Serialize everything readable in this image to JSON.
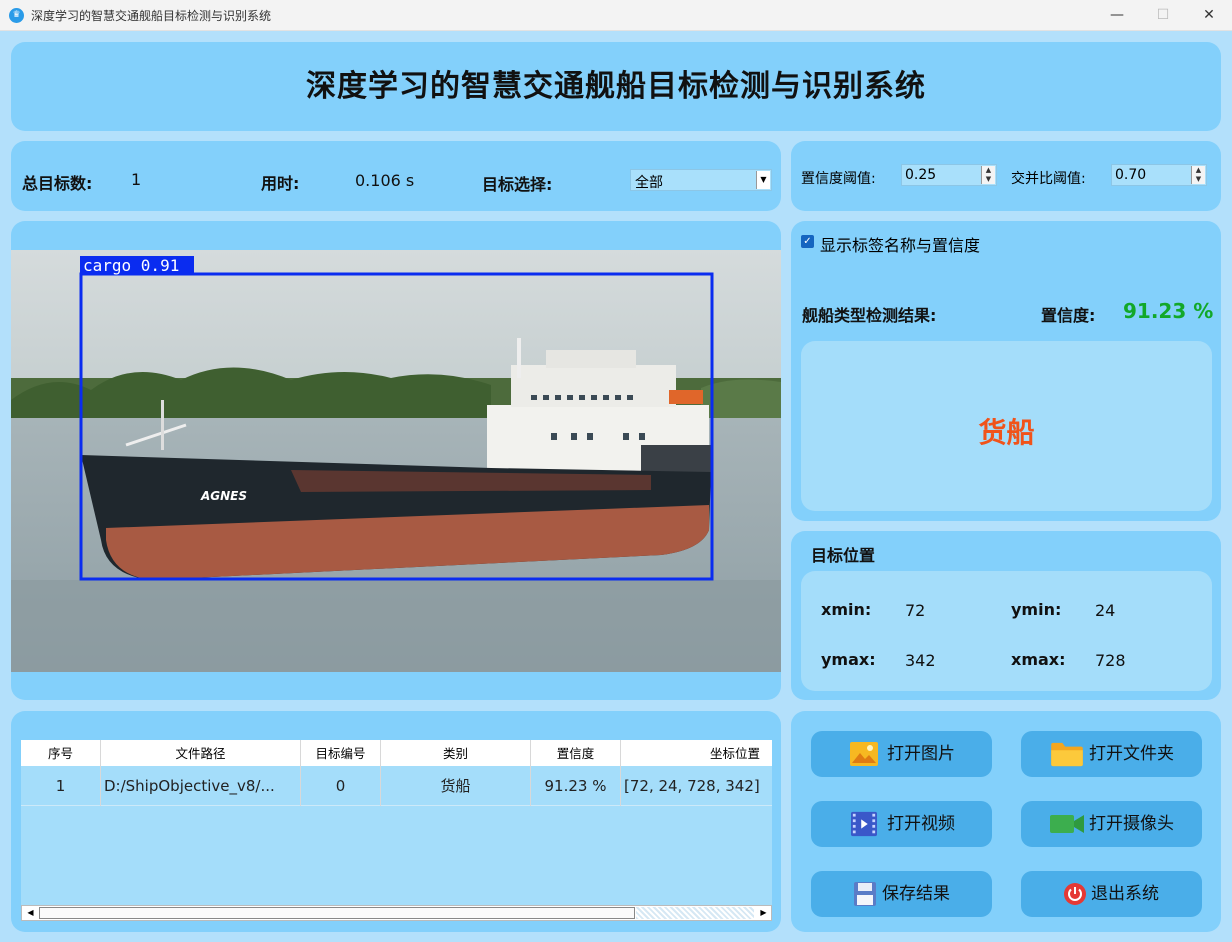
{
  "window": {
    "title": "深度学习的智慧交通舰船目标检测与识别系统",
    "minimize": "—",
    "maximize": "☐",
    "close": "✕"
  },
  "header": {
    "title": "深度学习的智慧交通舰船目标检测与识别系统"
  },
  "stats": {
    "total_label": "总目标数:",
    "total_value": "1",
    "time_label": "用时:",
    "time_value": "0.106 s",
    "select_label": "目标选择:",
    "select_value": "全部"
  },
  "thresholds": {
    "conf_label": "置信度阈值:",
    "conf_value": "0.25",
    "iou_label": "交并比阈值:",
    "iou_value": "0.70"
  },
  "detection": {
    "show_label_checkbox": "显示标签名称与置信度",
    "show_label_checked": true,
    "result_label": "舰船类型检测结果:",
    "conf_label": "置信度:",
    "conf_value": "91.23 %",
    "class_name": "货船",
    "box_label": "cargo 0.91",
    "hull_text": "AGNES"
  },
  "position": {
    "title": "目标位置",
    "xmin_label": "xmin:",
    "xmin_value": "72",
    "ymin_label": "ymin:",
    "ymin_value": "24",
    "ymax_label": "ymax:",
    "ymax_value": "342",
    "xmax_label": "xmax:",
    "xmax_value": "728"
  },
  "table": {
    "headers": [
      "序号",
      "文件路径",
      "目标编号",
      "类别",
      "置信度",
      "坐标位置"
    ],
    "rows": [
      [
        "1",
        "D:/ShipObjective_v8/...",
        "0",
        "货船",
        "91.23 %",
        "[72, 24, 728, 342]"
      ]
    ]
  },
  "buttons": {
    "open_image": "打开图片",
    "open_folder": "打开文件夹",
    "open_video": "打开视频",
    "open_camera": "打开摄像头",
    "save": "保存结果",
    "exit": "退出系统"
  },
  "colors": {
    "background": "#b3e0fb",
    "panel": "#83d0fb",
    "panel_light": "#a4ddfa",
    "button": "#4aaee9",
    "confidence": "#12a829",
    "class_text": "#f0531a",
    "box": "#0a2cf0"
  }
}
